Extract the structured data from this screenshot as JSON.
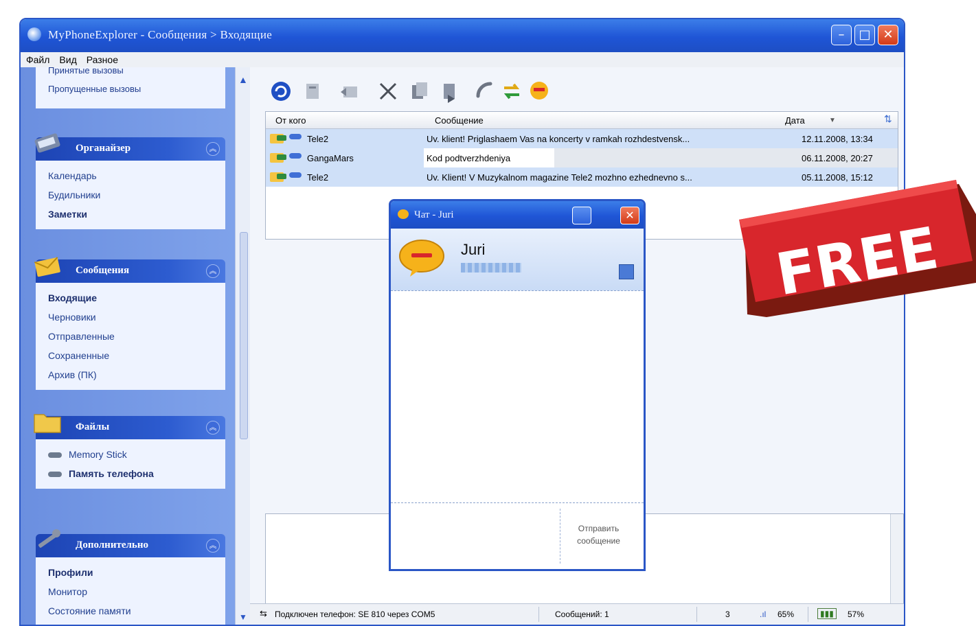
{
  "window": {
    "title": "MyPhoneExplorer - Сообщения > Входящие"
  },
  "menu": [
    "Файл",
    "Вид",
    "Разное"
  ],
  "sidebar": {
    "top_panel": {
      "items": [
        "Принятые вызовы",
        "Пропущенные вызовы"
      ]
    },
    "groups": [
      {
        "title": "Органайзер",
        "items": [
          {
            "label": "Календарь",
            "bold": false
          },
          {
            "label": "Будильники",
            "bold": false
          },
          {
            "label": "Заметки",
            "bold": true
          }
        ]
      },
      {
        "title": "Сообщения",
        "items": [
          {
            "label": "Входящие",
            "bold": true
          },
          {
            "label": "Черновики",
            "bold": false
          },
          {
            "label": "Отправленные",
            "bold": false
          },
          {
            "label": "Сохраненные",
            "bold": false
          },
          {
            "label": "Архив (ПК)",
            "bold": false
          }
        ]
      },
      {
        "title": "Файлы",
        "items": [
          {
            "label": "Memory Stick",
            "bold": false
          },
          {
            "label": "Память телефона",
            "bold": true
          }
        ]
      },
      {
        "title": "Дополнительно",
        "items": [
          {
            "label": "Профили",
            "bold": true
          },
          {
            "label": "Монитор",
            "bold": false
          },
          {
            "label": "Состояние памяти",
            "bold": false
          }
        ]
      }
    ]
  },
  "toolbar": [
    "refresh-icon",
    "new-icon",
    "reply-icon",
    "delete-icon",
    "copy-icon",
    "move-icon",
    "call-icon",
    "sync-icon",
    "chat-icon"
  ],
  "messages": {
    "columns": {
      "from": "От кого",
      "message": "Сообщение",
      "date": "Дата"
    },
    "rows": [
      {
        "from": "Tele2",
        "message": "Uv. klient! Priglashaem Vas na koncerty v ramkah rozhdestvensk...",
        "date": "12.11.2008, 13:34"
      },
      {
        "from": "GangaMars",
        "message": "Kod podtverzhdeniya",
        "date": "06.11.2008, 20:27"
      },
      {
        "from": "Tele2",
        "message": "Uv. Klient! V Muzykalnom magazine Tele2 mozhno ezhednevno s...",
        "date": "05.11.2008, 15:12"
      }
    ]
  },
  "statusbar": {
    "connection": "Подключен телефон: SE 810 через COM5",
    "messages_count": "Сообщений: 1",
    "signal_count": "3",
    "signal": "65%",
    "battery": "57%"
  },
  "chat": {
    "title": "Чат - Juri",
    "name": "Juri",
    "send_label": "Отправить сообщение"
  },
  "badge": {
    "text": "FREE"
  },
  "colors": {
    "accent": "#1f55d6",
    "sidebar": "#6b8fe0",
    "badge": "#d8262c"
  }
}
